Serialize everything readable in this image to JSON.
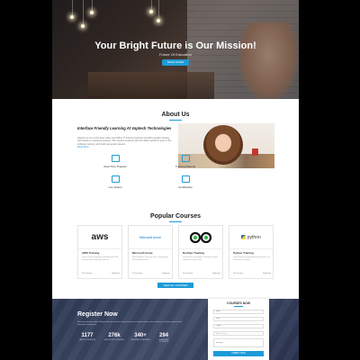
{
  "hero": {
    "title": "Your Bright Future is Our Mission!",
    "subtitle": "Future Of Education",
    "button": "READ MORE"
  },
  "about": {
    "title": "About Us",
    "heading": "Interface Friendly Learning At Vaptech Technologies",
    "text": "Vaptech is one of the best online and offline IT training institutes providing quality training with hands-on practical sessions. We prepare students with the skills needed to grow in the software industry and build successful careers.",
    "link": "Read More",
    "features": [
      {
        "label": "Real Time Projects",
        "icon": "projects-icon"
      },
      {
        "label": "Training Material",
        "icon": "book-icon"
      },
      {
        "label": "Live Videos",
        "icon": "video-icon"
      },
      {
        "label": "Certification",
        "icon": "certificate-icon"
      }
    ]
  },
  "courses": {
    "title": "Popular Courses",
    "items": [
      {
        "logo": "aws",
        "name": "AWS Training",
        "desc": "Learn cloud computing with Amazon Web Services from industry experts.",
        "lectures": "25 Lectures",
        "level": "Beginner"
      },
      {
        "logo": "Microsoft Azure",
        "name": "Microsoft Azure",
        "desc": "Master Azure cloud services, deployment and administration.",
        "lectures": "24 Lectures",
        "level": "Beginner"
      },
      {
        "logo": "DevOps",
        "name": "DevOps Training",
        "desc": "Continuous integration and delivery with modern DevOps tools.",
        "lectures": "30 Lectures",
        "level": "Beginner"
      },
      {
        "logo": "python",
        "name": "Python Training",
        "desc": "Learn Python programming from basics to advanced concepts.",
        "lectures": "28 Lectures",
        "level": "Beginner"
      }
    ],
    "button": "VIEW ALL COURSES"
  },
  "register": {
    "title": "Register Now",
    "text": "Start your journey today. Register for our courses and get access to expert trainers, live sessions, real-time projects and placement assistance.",
    "stats": [
      {
        "num": "1177",
        "cap": "HAPPY STUDENTS"
      },
      {
        "num": "276k",
        "cap": "APPROVED COURSES"
      },
      {
        "num": "340+",
        "cap": "CERTIFIED TEACHERS"
      },
      {
        "num": "294",
        "cap": "GRADUATE STUDENTS"
      }
    ]
  },
  "form": {
    "title": "COURSES NOW",
    "name_placeholder": "Name",
    "email_placeholder": "Email",
    "phone_placeholder": "Phone",
    "course_placeholder": "Select Course",
    "message_placeholder": "Message",
    "button": "SUBMIT NOW"
  },
  "colors": {
    "accent": "#1e9bd7",
    "register_bg": "#2f3a56"
  }
}
